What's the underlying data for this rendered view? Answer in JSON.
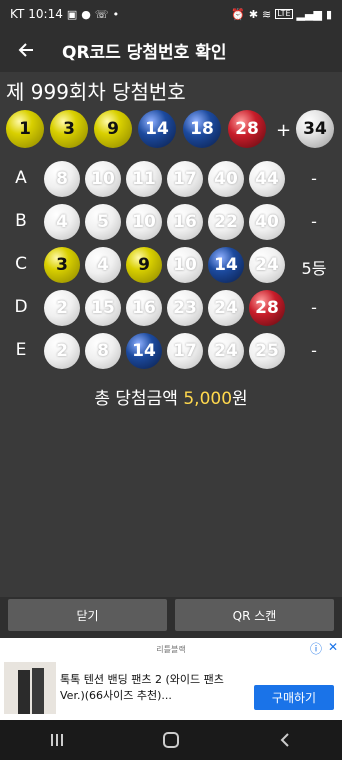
{
  "status_bar": {
    "carrier": "KT",
    "time": "10:14",
    "left_icons": [
      "image-icon",
      "chat-icon",
      "wifi-call-icon",
      "dot-icon"
    ],
    "right_icons": [
      "alarm-icon",
      "bluetooth-icon",
      "wifi-icon",
      "lte-icon",
      "signal-icon",
      "battery-icon"
    ],
    "lte_label": "LTE"
  },
  "app_bar": {
    "title": "QR코드 당첨번호 확인"
  },
  "draw": {
    "title": "제 999회차 당첨번호",
    "winning_numbers": [
      1,
      3,
      9,
      14,
      18,
      28
    ],
    "plus": "+",
    "bonus": 34
  },
  "tickets": [
    {
      "label": "A",
      "numbers": [
        8,
        10,
        11,
        17,
        40,
        44
      ],
      "result": "-"
    },
    {
      "label": "B",
      "numbers": [
        4,
        5,
        10,
        16,
        22,
        40
      ],
      "result": "-"
    },
    {
      "label": "C",
      "numbers": [
        3,
        4,
        9,
        10,
        14,
        24
      ],
      "result": "5등"
    },
    {
      "label": "D",
      "numbers": [
        2,
        15,
        16,
        23,
        24,
        28
      ],
      "result": "-"
    },
    {
      "label": "E",
      "numbers": [
        2,
        8,
        14,
        17,
        24,
        25
      ],
      "result": "-"
    }
  ],
  "total": {
    "prefix": "총 당첨금액",
    "amount": "5,000",
    "suffix": "원"
  },
  "buttons": {
    "close": "닫기",
    "qr_scan": "QR 스캔"
  },
  "ad": {
    "source": "리틀블랙",
    "text": "톡톡 텐션 밴딩 팬츠 2 (와이드 팬츠 Ver.)(66사이즈 추천)...",
    "cta": "구매하기"
  },
  "nav": {
    "icons": [
      "recent-apps-icon",
      "home-icon",
      "back-icon"
    ]
  },
  "colors": {
    "ball_yellow": "#d9d000",
    "ball_blue": "#1c4a9e",
    "ball_red": "#c81d2a",
    "ball_gray": "#e2e2e2",
    "amount_highlight": "#ffd84d",
    "ad_cta": "#1a73e8"
  }
}
